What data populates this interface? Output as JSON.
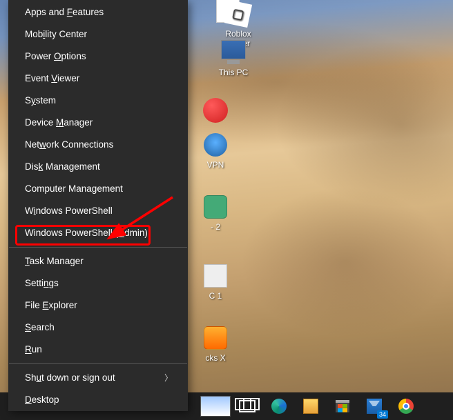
{
  "desktop_icons": {
    "roblox": "Roblox\nPlayer",
    "thispc": "This PC",
    "vpn_suffix": "VPN",
    "item2_suffix": "- 2",
    "itemc1_suffix": "C 1",
    "itemx_suffix": "cks X"
  },
  "winx": {
    "items": [
      {
        "pre": "Apps and ",
        "u": "F",
        "post": "eatures"
      },
      {
        "pre": "Mob",
        "u": "i",
        "post": "lity Center"
      },
      {
        "pre": "Power ",
        "u": "O",
        "post": "ptions"
      },
      {
        "pre": "Event ",
        "u": "V",
        "post": "iewer"
      },
      {
        "pre": "S",
        "u": "y",
        "post": "stem"
      },
      {
        "pre": "Device ",
        "u": "M",
        "post": "anager"
      },
      {
        "pre": "Net",
        "u": "w",
        "post": "ork Connections"
      },
      {
        "pre": "Dis",
        "u": "k",
        "post": " Management"
      },
      {
        "pre": "Computer Mana",
        "u": "g",
        "post": "ement"
      },
      {
        "pre": "W",
        "u": "i",
        "post": "ndows PowerShell"
      },
      {
        "pre": "Windows PowerShell (",
        "u": "A",
        "post": "dmin)"
      }
    ],
    "items2": [
      {
        "pre": "",
        "u": "T",
        "post": "ask Manager"
      },
      {
        "pre": "Setti",
        "u": "n",
        "post": "gs"
      },
      {
        "pre": "File ",
        "u": "E",
        "post": "xplorer"
      },
      {
        "pre": "",
        "u": "S",
        "post": "earch"
      },
      {
        "pre": "",
        "u": "R",
        "post": "un"
      }
    ],
    "items3": [
      {
        "pre": "Sh",
        "u": "u",
        "post": "t down or sign out",
        "submenu": true
      },
      {
        "pre": "",
        "u": "D",
        "post": "esktop"
      }
    ]
  },
  "taskbar": {
    "mail_badge": "34"
  }
}
